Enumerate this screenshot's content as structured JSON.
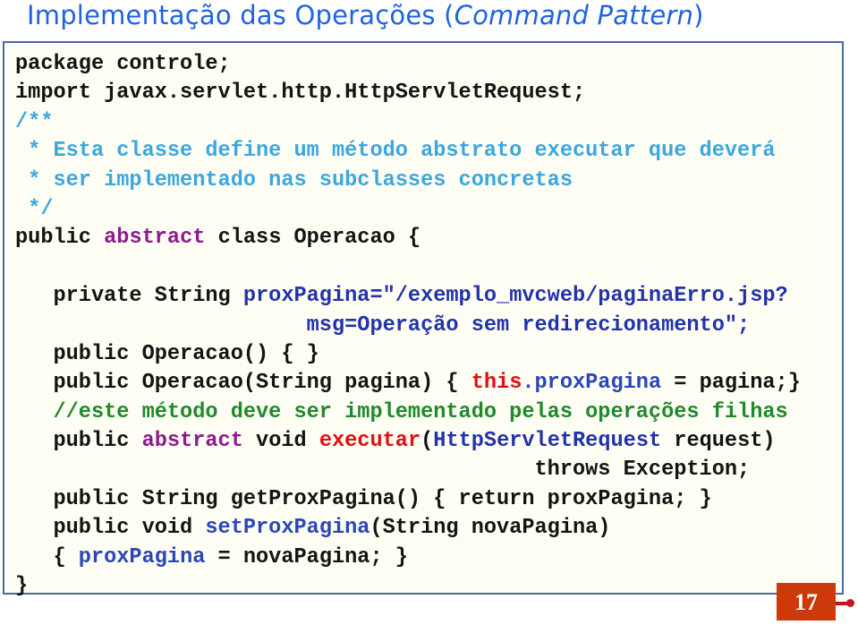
{
  "title": {
    "prefix": "Implementação das Operações (",
    "emphasis": "Command Pattern",
    "suffix": ")"
  },
  "code": {
    "lines": [
      [
        {
          "t": "package controle;",
          "k": "plain"
        }
      ],
      [
        {
          "t": "import javax.servlet.http.HttpServletRequest;",
          "k": "plain"
        }
      ],
      [
        {
          "t": "/**",
          "k": "comment"
        }
      ],
      [
        {
          "t": " * Esta classe define um método abstrato executar que deverá",
          "k": "comment"
        }
      ],
      [
        {
          "t": " * ser implementado nas subclasses concretas",
          "k": "comment"
        }
      ],
      [
        {
          "t": " */",
          "k": "comment"
        }
      ],
      [
        {
          "t": "public ",
          "k": "plain"
        },
        {
          "t": "abstract",
          "k": "purple"
        },
        {
          "t": " class Operacao {",
          "k": "plain"
        }
      ],
      [
        {
          "t": "",
          "k": "plain"
        }
      ],
      [
        {
          "t": "   private String ",
          "k": "plain"
        },
        {
          "t": "proxPagina=\"/exemplo_mvcweb/paginaErro.jsp?",
          "k": "blue"
        }
      ],
      [
        {
          "t": "                       msg=Operação sem redirecionamento\";",
          "k": "blue"
        }
      ],
      [
        {
          "t": "   public Operacao() { }",
          "k": "plain"
        }
      ],
      [
        {
          "t": "   public Operacao(String pagina) { ",
          "k": "plain"
        },
        {
          "t": "this",
          "k": "red"
        },
        {
          "t": ".proxPagina",
          "k": "field"
        },
        {
          "t": " = pagina;}",
          "k": "plain"
        }
      ],
      [
        {
          "t": "   //este método deve ser implementado pelas operações filhas",
          "k": "green"
        }
      ],
      [
        {
          "t": "   public ",
          "k": "plain"
        },
        {
          "t": "abstract",
          "k": "purple"
        },
        {
          "t": " void ",
          "k": "plain"
        },
        {
          "t": "executar",
          "k": "red"
        },
        {
          "t": "(",
          "k": "plain"
        },
        {
          "t": "HttpServletRequest",
          "k": "blue"
        },
        {
          "t": " request)",
          "k": "plain"
        }
      ],
      [
        {
          "t": "                                         throws Exception;",
          "k": "plain"
        }
      ],
      [
        {
          "t": "   public String getProxPagina() { return proxPagina; }",
          "k": "plain"
        }
      ],
      [
        {
          "t": "   public void ",
          "k": "plain"
        },
        {
          "t": "setProxPagina",
          "k": "field"
        },
        {
          "t": "(String novaPagina)",
          "k": "plain"
        }
      ],
      [
        {
          "t": "   { ",
          "k": "plain"
        },
        {
          "t": "proxPagina",
          "k": "field"
        },
        {
          "t": " = novaPagina; }",
          "k": "plain"
        }
      ],
      [
        {
          "t": "}",
          "k": "plain"
        }
      ]
    ]
  },
  "page_number": "17"
}
